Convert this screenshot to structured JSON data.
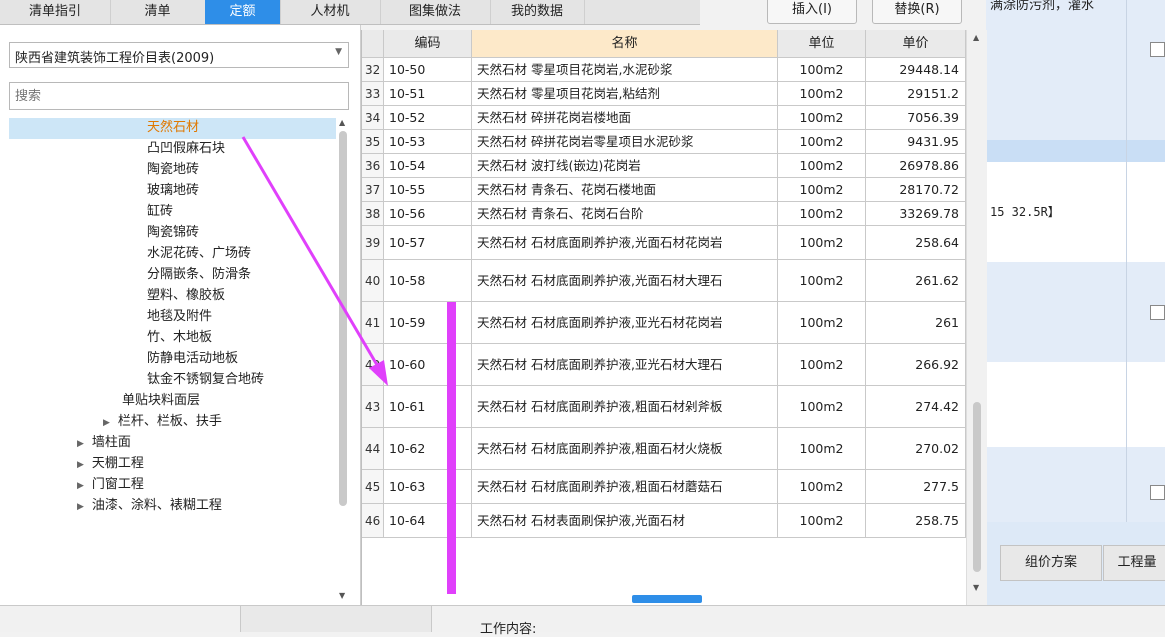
{
  "top_tabs": [
    {
      "label": "清单指引"
    },
    {
      "label": "清单"
    },
    {
      "label": "定额"
    },
    {
      "label": "人材机"
    },
    {
      "label": "图集做法"
    },
    {
      "label": "我的数据"
    }
  ],
  "buttons": {
    "insert": "插入(I)",
    "replace": "替换(R)"
  },
  "colors": {
    "active_tab": "#2e8ee8",
    "selected_tree": "#cde6f7",
    "arrow": "#e040fb"
  },
  "left": {
    "dropdown_value": "陕西省建筑装饰工程价目表(2009)",
    "search_placeholder": "搜索",
    "tree": [
      {
        "label": "天然石材",
        "selected": true
      },
      {
        "label": "凸凹假麻石块"
      },
      {
        "label": "陶瓷地砖"
      },
      {
        "label": "玻璃地砖"
      },
      {
        "label": "缸砖"
      },
      {
        "label": "陶瓷锦砖"
      },
      {
        "label": "水泥花砖、广场砖"
      },
      {
        "label": "分隔嵌条、防滑条"
      },
      {
        "label": "塑料、橡胶板"
      },
      {
        "label": "地毯及附件"
      },
      {
        "label": "竹、木地板"
      },
      {
        "label": "防静电活动地板"
      },
      {
        "label": "钛金不锈钢复合地砖"
      },
      {
        "label": "单贴块料面层"
      },
      {
        "label": "栏杆、栏板、扶手"
      },
      {
        "label": "墙柱面"
      },
      {
        "label": "天棚工程"
      },
      {
        "label": "门窗工程"
      },
      {
        "label": "油漆、涂料、裱糊工程"
      }
    ]
  },
  "table": {
    "headers": {
      "code": "编码",
      "name": "名称",
      "unit": "单位",
      "price": "单价"
    },
    "rows": [
      {
        "idx": "32",
        "code": "10-50",
        "name": "天然石材 零星项目花岗岩,水泥砂浆",
        "unit": "100m2",
        "price": "29448.14"
      },
      {
        "idx": "33",
        "code": "10-51",
        "name": "天然石材 零星项目花岗岩,粘结剂",
        "unit": "100m2",
        "price": "29151.2"
      },
      {
        "idx": "34",
        "code": "10-52",
        "name": "天然石材 碎拼花岗岩楼地面",
        "unit": "100m2",
        "price": "7056.39"
      },
      {
        "idx": "35",
        "code": "10-53",
        "name": "天然石材 碎拼花岗岩零星项目水泥砂浆",
        "unit": "100m2",
        "price": "9431.95"
      },
      {
        "idx": "36",
        "code": "10-54",
        "name": "天然石材 波打线(嵌边)花岗岩",
        "unit": "100m2",
        "price": "26978.86"
      },
      {
        "idx": "37",
        "code": "10-55",
        "name": "天然石材 青条石、花岗石楼地面",
        "unit": "100m2",
        "price": "28170.72"
      },
      {
        "idx": "38",
        "code": "10-56",
        "name": "天然石材 青条石、花岗石台阶",
        "unit": "100m2",
        "price": "33269.78"
      },
      {
        "idx": "39",
        "code": "10-57",
        "name": "天然石材 石材底面刷养护液,光面石材花岗岩",
        "unit": "100m2",
        "price": "258.64"
      },
      {
        "idx": "40",
        "code": "10-58",
        "name": "天然石材 石材底面刷养护液,光面石材大理石",
        "unit": "100m2",
        "price": "261.62"
      },
      {
        "idx": "41",
        "code": "10-59",
        "name": "天然石材 石材底面刷养护液,亚光石材花岗岩",
        "unit": "100m2",
        "price": "261"
      },
      {
        "idx": "42",
        "code": "10-60",
        "name": "天然石材 石材底面刷养护液,亚光石材大理石",
        "unit": "100m2",
        "price": "266.92"
      },
      {
        "idx": "43",
        "code": "10-61",
        "name": "天然石材 石材底面刷养护液,粗面石材剁斧板",
        "unit": "100m2",
        "price": "274.42"
      },
      {
        "idx": "44",
        "code": "10-62",
        "name": "天然石材 石材底面刷养护液,粗面石材火烧板",
        "unit": "100m2",
        "price": "270.02"
      },
      {
        "idx": "45",
        "code": "10-63",
        "name": "天然石材 石材底面刷养护液,粗面石材蘑菇石",
        "unit": "100m2",
        "price": "277.5"
      },
      {
        "idx": "46",
        "code": "10-64",
        "name": "天然石材 石材表面刷保护液,光面石材",
        "unit": "100m2",
        "price": "258.75"
      }
    ]
  },
  "right": {
    "text_top": "满涂防污剂，灌水",
    "text_mid": "15 32.5R】",
    "tab_plan": "组价方案",
    "tab_qty": "工程量"
  },
  "bottom": {
    "work_content": "工作内容:"
  }
}
